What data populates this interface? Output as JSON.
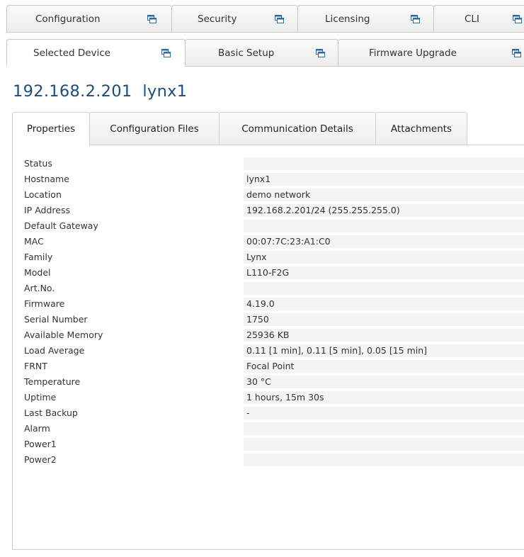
{
  "top_tabs": [
    {
      "label": "Configuration",
      "icon": "window-icon"
    },
    {
      "label": "Security",
      "icon": "window-icon"
    },
    {
      "label": "Licensing",
      "icon": "window-icon"
    },
    {
      "label": "CLI",
      "icon": "window-icon"
    }
  ],
  "second_tabs": [
    {
      "label": "Selected Device",
      "icon": "window-icon",
      "active": true
    },
    {
      "label": "Basic Setup",
      "icon": "window-icon"
    },
    {
      "label": "Firmware Upgrade",
      "icon": "window-icon"
    }
  ],
  "device_title": "192.168.2.201  lynx1",
  "property_tabs": [
    {
      "label": "Properties",
      "active": true
    },
    {
      "label": "Configuration Files"
    },
    {
      "label": "Communication Details"
    },
    {
      "label": "Attachments"
    }
  ],
  "properties": [
    {
      "key": "Status",
      "value": ""
    },
    {
      "key": "Hostname",
      "value": "lynx1"
    },
    {
      "key": "Location",
      "value": "demo network"
    },
    {
      "key": "IP Address",
      "value": "192.168.2.201/24 (255.255.255.0)"
    },
    {
      "key": "Default Gateway",
      "value": ""
    },
    {
      "key": "MAC",
      "value": "00:07:7C:23:A1:C0"
    },
    {
      "key": "Family",
      "value": "Lynx"
    },
    {
      "key": "Model",
      "value": "L110-F2G"
    },
    {
      "key": "Art.No.",
      "value": ""
    },
    {
      "key": "Firmware",
      "value": "4.19.0"
    },
    {
      "key": "Serial Number",
      "value": "1750"
    },
    {
      "key": "Available Memory",
      "value": "25936 KB"
    },
    {
      "key": "Load Average",
      "value": "0.11 [1 min],  0.11 [5 min],  0.05 [15 min]"
    },
    {
      "key": "FRNT",
      "value": "Focal Point"
    },
    {
      "key": "Temperature",
      "value": "30 °C"
    },
    {
      "key": "Uptime",
      "value": "1 hours, 15m 30s"
    },
    {
      "key": "Last Backup",
      "value": "-"
    },
    {
      "key": "Alarm",
      "value": ""
    },
    {
      "key": "Power1",
      "value": ""
    },
    {
      "key": "Power2",
      "value": ""
    }
  ],
  "colors": {
    "title": "#1e4d7b",
    "icon": "#2a6aa8",
    "value_bg": "#f3f3f3"
  }
}
